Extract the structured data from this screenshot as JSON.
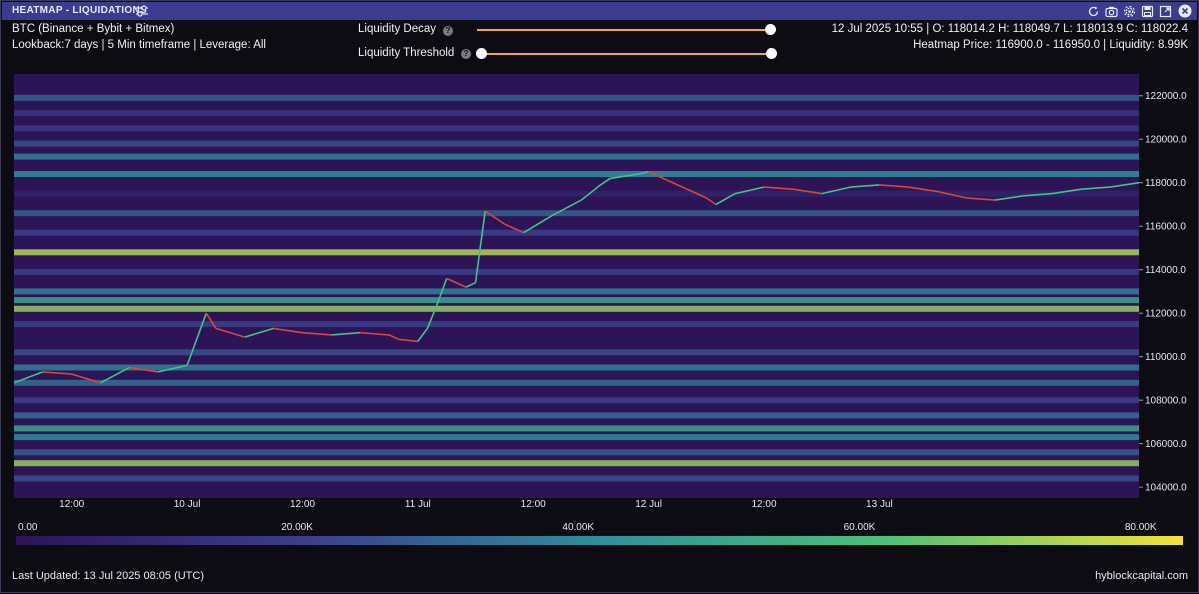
{
  "window": {
    "title": "HEATMAP - LIQUIDATIONS",
    "icons": [
      "refresh-icon",
      "camera-icon",
      "settings-icon",
      "save-icon",
      "expand-icon",
      "close-icon"
    ]
  },
  "info": {
    "line1": "BTC (Binance + Bybit + Bitmex)",
    "line2": "Lookback:7 days | 5 Min timeframe | Leverage: All",
    "ohlc": "12 Jul 2025 10:55 | O: 118014.2 H: 118049.7 L: 118013.9 C: 118022.4",
    "heatmap_price": "Heatmap Price: 116900.0 - 116950.0 | Liquidity: 8.99K"
  },
  "controls": {
    "decay_label": "Liquidity Decay",
    "threshold_label": "Liquidity Threshold",
    "help_glyph": "?",
    "decay_value": 1.0,
    "threshold_range": [
      0.0,
      1.0
    ]
  },
  "colors": {
    "accent": "#f0a64a",
    "titlebar": "#3b3b8f",
    "heat_low": "#2d1457",
    "heat_mid": "#2f8f9a",
    "heat_high": "#f5e23a",
    "candle_up": "#3fc48a",
    "candle_down": "#d9463c"
  },
  "chart_data": {
    "type": "heatmap",
    "ylim": [
      103500,
      123000
    ],
    "y_ticks": [
      "122000.0",
      "120000.0",
      "118000.0",
      "116000.0",
      "114000.0",
      "112000.0",
      "110000.0",
      "108000.0",
      "106000.0",
      "104000.0"
    ],
    "y_tick_values": [
      122000,
      120000,
      118000,
      116000,
      114000,
      112000,
      110000,
      108000,
      106000,
      104000
    ],
    "x_ticks": [
      "12:00",
      "10 Jul",
      "12:00",
      "11 Jul",
      "12:00",
      "12 Jul",
      "12:00",
      "13 Jul"
    ],
    "price_series": [
      {
        "t": "9 Jul 06:00",
        "close": 108800
      },
      {
        "t": "9 Jul 09:00",
        "close": 109300
      },
      {
        "t": "9 Jul 12:00",
        "close": 109200
      },
      {
        "t": "9 Jul 15:00",
        "close": 108800
      },
      {
        "t": "9 Jul 18:00",
        "close": 109500
      },
      {
        "t": "9 Jul 21:00",
        "close": 109300
      },
      {
        "t": "10 Jul 00:00",
        "close": 109600
      },
      {
        "t": "10 Jul 02:00",
        "close": 112000
      },
      {
        "t": "10 Jul 03:00",
        "close": 111300
      },
      {
        "t": "10 Jul 06:00",
        "close": 110900
      },
      {
        "t": "10 Jul 09:00",
        "close": 111300
      },
      {
        "t": "10 Jul 12:00",
        "close": 111100
      },
      {
        "t": "10 Jul 15:00",
        "close": 111000
      },
      {
        "t": "10 Jul 18:00",
        "close": 111100
      },
      {
        "t": "10 Jul 21:00",
        "close": 111000
      },
      {
        "t": "10 Jul 22:00",
        "close": 110800
      },
      {
        "t": "11 Jul 00:00",
        "close": 110700
      },
      {
        "t": "11 Jul 01:00",
        "close": 111300
      },
      {
        "t": "11 Jul 02:00",
        "close": 112400
      },
      {
        "t": "11 Jul 03:00",
        "close": 113600
      },
      {
        "t": "11 Jul 05:00",
        "close": 113200
      },
      {
        "t": "11 Jul 06:00",
        "close": 113400
      },
      {
        "t": "11 Jul 07:00",
        "close": 116700
      },
      {
        "t": "11 Jul 09:00",
        "close": 116100
      },
      {
        "t": "11 Jul 11:00",
        "close": 115700
      },
      {
        "t": "11 Jul 14:00",
        "close": 116500
      },
      {
        "t": "11 Jul 17:00",
        "close": 117200
      },
      {
        "t": "11 Jul 19:00",
        "close": 117900
      },
      {
        "t": "11 Jul 20:00",
        "close": 118200
      },
      {
        "t": "11 Jul 23:00",
        "close": 118400
      },
      {
        "t": "12 Jul 00:00",
        "close": 118500
      },
      {
        "t": "12 Jul 02:00",
        "close": 118100
      },
      {
        "t": "12 Jul 04:00",
        "close": 117700
      },
      {
        "t": "12 Jul 06:00",
        "close": 117300
      },
      {
        "t": "12 Jul 07:00",
        "close": 117000
      },
      {
        "t": "12 Jul 09:00",
        "close": 117500
      },
      {
        "t": "12 Jul 12:00",
        "close": 117800
      },
      {
        "t": "12 Jul 15:00",
        "close": 117700
      },
      {
        "t": "12 Jul 18:00",
        "close": 117500
      },
      {
        "t": "12 Jul 21:00",
        "close": 117800
      },
      {
        "t": "13 Jul 00:00",
        "close": 117900
      },
      {
        "t": "13 Jul 03:00",
        "close": 117800
      },
      {
        "t": "13 Jul 06:00",
        "close": 117600
      },
      {
        "t": "13 Jul 09:00",
        "close": 117300
      },
      {
        "t": "13 Jul 12:00",
        "close": 117200
      },
      {
        "t": "13 Jul 15:00",
        "close": 117400
      },
      {
        "t": "13 Jul 18:00",
        "close": 117500
      },
      {
        "t": "13 Jul 21:00",
        "close": 117700
      },
      {
        "t": "14 Jul 00:00",
        "close": 117800
      },
      {
        "t": "14 Jul 03:00",
        "close": 118000
      }
    ],
    "liquidity_bands": [
      {
        "price": 121900,
        "level": 0.35
      },
      {
        "price": 121200,
        "level": 0.2
      },
      {
        "price": 120500,
        "level": 0.22
      },
      {
        "price": 119800,
        "level": 0.3
      },
      {
        "price": 119200,
        "level": 0.45
      },
      {
        "price": 118400,
        "level": 0.5
      },
      {
        "price": 117500,
        "level": 0.1
      },
      {
        "price": 116600,
        "level": 0.35
      },
      {
        "price": 115700,
        "level": 0.25
      },
      {
        "price": 114800,
        "level": 0.9
      },
      {
        "price": 113900,
        "level": 0.25
      },
      {
        "price": 113000,
        "level": 0.45
      },
      {
        "price": 112600,
        "level": 0.6
      },
      {
        "price": 112200,
        "level": 0.85
      },
      {
        "price": 111500,
        "level": 0.25
      },
      {
        "price": 110200,
        "level": 0.3
      },
      {
        "price": 109500,
        "level": 0.45
      },
      {
        "price": 108800,
        "level": 0.4
      },
      {
        "price": 108000,
        "level": 0.25
      },
      {
        "price": 107300,
        "level": 0.4
      },
      {
        "price": 106700,
        "level": 0.6
      },
      {
        "price": 106300,
        "level": 0.5
      },
      {
        "price": 105600,
        "level": 0.35
      },
      {
        "price": 105100,
        "level": 0.85
      },
      {
        "price": 104400,
        "level": 0.3
      }
    ],
    "colorbar": {
      "ticks": [
        "0.00",
        "20.00K",
        "40.00K",
        "60.00K",
        "80.00K"
      ],
      "tick_values": [
        0,
        20000,
        40000,
        60000,
        80000
      ],
      "max": 83000
    }
  },
  "footer": {
    "last_updated": "Last Updated: 13 Jul 2025 08:05 (UTC)",
    "brand": "hyblockcapital.com"
  }
}
